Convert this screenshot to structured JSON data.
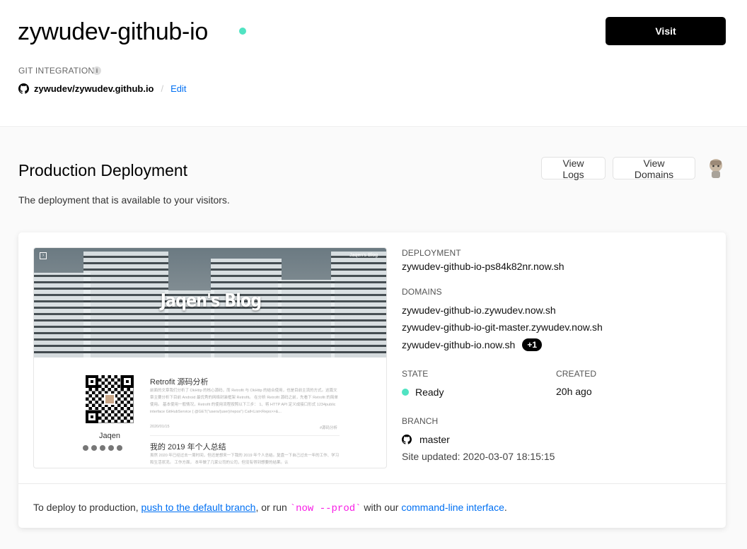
{
  "header": {
    "project_name": "zywudev-github-io",
    "visit_label": "Visit",
    "git_integration_label": "GIT INTEGRATION",
    "info_icon": "i",
    "repo": "zywudev/zywudev.github.io",
    "separator": "/",
    "edit_label": "Edit"
  },
  "production": {
    "title": "Production Deployment",
    "subtitle": "The deployment that is available to your visitors.",
    "view_logs_label": "View Logs",
    "view_domains_label": "View Domains"
  },
  "preview": {
    "menu_glyph": "›",
    "brand": "Jaqen's Blog",
    "hero_title": "Jaqen's Blog",
    "author": "Jaqen",
    "posts": [
      {
        "title": "Retrofit 源码分析",
        "excerpt": "前面的文章我们分析了 OkHttp 的核心源码，而 Retrofit 与 OkHttp 的结合使用，也是目前主流的方式。这篇文章主要分析下目前 Android 最优秀的网络封装框架 Retrofit。 在分析 Retrofit 源码之前，先看下 Retrofit 的简单使用。 基本使用一般情况，Retrofit 的使用流程按照以下三步： 1、将 HTTP API 定义成接口形式 1234public interface GitHubService { @GET(\"users/{user}/repos\") Call<List<Repo>>&...",
        "date": "2020/01/15",
        "tag": "#源码分析"
      },
      {
        "title": "我的 2019 年个人总结",
        "excerpt": "虽然 2020 年已经过去一周时间，但还是想来一下我的 2019 年个人总结。复盘一下自己过去一年的工作、学习和生活状况。 工作方面， 本年做了几家公司的公司，但没有得到想要的结果。认"
      }
    ]
  },
  "deployment": {
    "deployment_label": "DEPLOYMENT",
    "deployment_url": "zywudev-github-io-ps84k82nr.now.sh",
    "domains_label": "DOMAINS",
    "domains": [
      "zywudev-github-io.zywudev.now.sh",
      "zywudev-github-io-git-master.zywudev.now.sh",
      "zywudev-github-io.now.sh"
    ],
    "more_domains": "+1",
    "state_label": "STATE",
    "state_value": "Ready",
    "created_label": "CREATED",
    "created_value": "20h ago",
    "branch_label": "BRANCH",
    "branch_value": "master",
    "site_updated": "Site updated: 2020-03-07 18:15:15"
  },
  "footer": {
    "prefix": "To deploy to production, ",
    "link1": "push to the default branch",
    "middle": ", or run ",
    "command": "`now --prod`",
    "suffix1": " with our ",
    "link2": "command-line interface",
    "suffix2": "."
  },
  "colors": {
    "accent": "#0070f3",
    "status_ready": "#50e3c2",
    "command": "#f81ce5"
  },
  "icons": {
    "repo": "github-icon",
    "info": "info-icon",
    "branch": "github-icon"
  }
}
